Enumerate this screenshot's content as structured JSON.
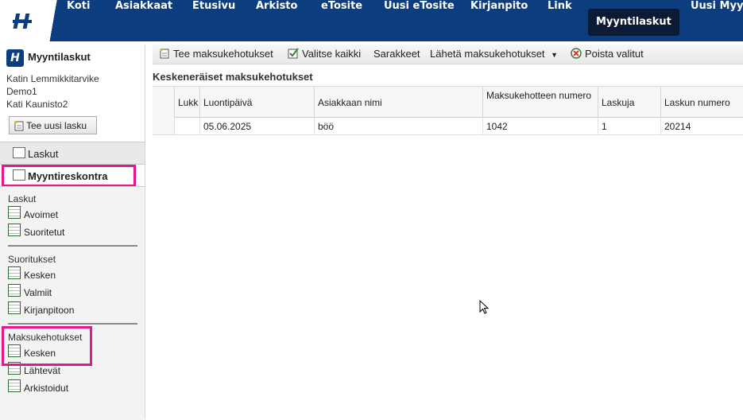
{
  "nav": {
    "items": [
      "Koti",
      "Asiakkaat",
      "Etusivu",
      "Arkisto",
      "eTosite",
      "Uusi eTosite",
      "Kirjanpito",
      "Link",
      "Myyntilaskut",
      "Uusi Myyntilaskut"
    ],
    "active": "Myyntilaskut",
    "colors": {
      "bar": "#0c3d7e",
      "active": "#0b1b36"
    }
  },
  "sidebar": {
    "title": "Myyntilaskut",
    "users": [
      "Katin Lemmikkitarvike",
      "Demo1",
      "Kati Kaunisto2"
    ],
    "new_invoice_button": "Tee uusi lasku",
    "tabs": [
      "Laskut",
      "Myyntireskontra"
    ],
    "selected_tab": "Myyntireskontra",
    "sections": [
      {
        "title": "Laskut",
        "links": [
          "Avoimet",
          "Suoritetut"
        ]
      },
      {
        "title": "Suoritukset",
        "links": [
          "Kesken",
          "Valmiit",
          "Kirjanpitoon"
        ]
      },
      {
        "title": "Maksukehotukset",
        "links": [
          "Kesken",
          "Lähtevät",
          "Arkistoidut"
        ]
      }
    ],
    "highlight_color": "#e6178c"
  },
  "toolbar": {
    "create": "Tee maksukehotukset",
    "select_all": "Valitse kaikki",
    "columns": "Sarakkeet",
    "send": "Lähetä maksukehotukset",
    "delete": "Poista valitut"
  },
  "section_title": "Keskeneräiset maksukehotukset",
  "table": {
    "headers": [
      "Lukk",
      "Luontipäivä",
      "Asiakkaan nimi",
      "Maksukehotteen numero",
      "Laskuja",
      "Laskun numero"
    ],
    "rows": [
      {
        "lukk": "",
        "date": "05.06.2025",
        "customer": "böö",
        "number": "1042",
        "invoices": "1",
        "invoice_number": "20214"
      }
    ]
  }
}
